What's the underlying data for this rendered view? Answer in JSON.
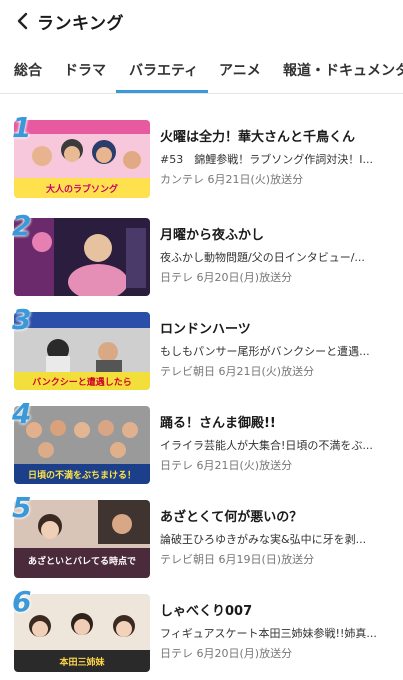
{
  "header": {
    "title": "ランキング",
    "back_icon": "chevron-left-icon"
  },
  "tabs": [
    {
      "label": "総合"
    },
    {
      "label": "ドラマ"
    },
    {
      "label": "バラエティ",
      "active": true
    },
    {
      "label": "アニメ"
    },
    {
      "label": "報道・ドキュメンタリー"
    }
  ],
  "colors": {
    "accent": "#3a9ad9",
    "text": "#1a1a1a",
    "subtext": "#777777"
  },
  "ranking": [
    {
      "rank": "1",
      "title": "火曜は全力！華大さんと千鳥くん",
      "episode": "#53　錦鯉参戦！ラブソング作詞対決！Ⅰ...",
      "broadcaster": "カンテレ",
      "aired": "6月21日(火)放送分",
      "thumb_caption": "大人のラブソング"
    },
    {
      "rank": "2",
      "title": "月曜から夜ふかし",
      "episode": "夜ふかし動物問題/父の日インタビュー/...",
      "broadcaster": "日テレ",
      "aired": "6月20日(月)放送分",
      "thumb_caption": ""
    },
    {
      "rank": "3",
      "title": "ロンドンハーツ",
      "episode": "もしもパンサー尾形がバンクシーと遭遇...",
      "broadcaster": "テレビ朝日",
      "aired": "6月21日(火)放送分",
      "thumb_caption": "バンクシーと遭遇したら"
    },
    {
      "rank": "4",
      "title": "踊る！さんま御殿!!",
      "episode": "イライラ芸能人が大集合!日頃の不満をぶ...",
      "broadcaster": "日テレ",
      "aired": "6月21日(火)放送分",
      "thumb_caption": "日頃の不満をぶちまける！"
    },
    {
      "rank": "5",
      "title": "あざとくて何が悪いの？",
      "episode": "論破王ひろゆきがみな実&弘中に牙を剥...",
      "broadcaster": "テレビ朝日",
      "aired": "6月19日(日)放送分",
      "thumb_caption": "あざといとバレてる時点で"
    },
    {
      "rank": "6",
      "title": "しゃべくり007",
      "episode": "フィギュアスケート本田三姉妹参戦!!姉真...",
      "broadcaster": "日テレ",
      "aired": "6月20日(月)放送分",
      "thumb_caption": "本田三姉妹"
    }
  ]
}
